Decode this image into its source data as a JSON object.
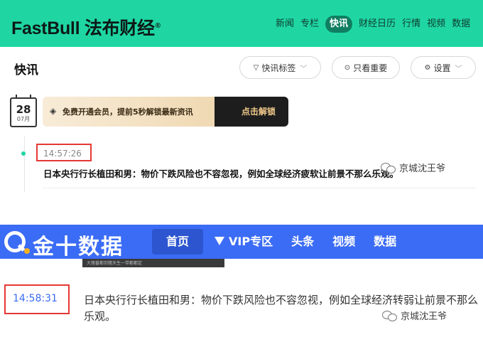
{
  "fastbull": {
    "logo": "FastBull 法布财经",
    "logo_reg": "®",
    "nav": [
      "新闻",
      "专栏",
      "快讯",
      "财经日历",
      "行情",
      "视频",
      "数据"
    ],
    "nav_active": "快讯",
    "page_title": "快讯",
    "filters": {
      "tags_label": "快讯标签",
      "important_label": "只看重要",
      "settings_label": "设置"
    },
    "calendar": {
      "day": "28",
      "month": "07月"
    },
    "vip_banner": {
      "text": "免费开通会员，提前5秒解锁最新资讯",
      "button": "点击解锁",
      "colors": {
        "banner": "#f0d9b3",
        "button_bg": "#1d1d1d",
        "button_text": "#f1c98a"
      }
    },
    "item": {
      "time": "14:57:26",
      "text": "日本央行行长植田和男：物价下跌风险也不容忽视，例如全球经济疲软让前景不那么乐观。"
    },
    "colors": {
      "header_bg": "#1fd6a3",
      "nav_active_bg": "#0f7e61"
    }
  },
  "jin10": {
    "logo": "金十数据",
    "nav": [
      "首页",
      "VIP专区",
      "头条",
      "视频",
      "数据"
    ],
    "nav_active": "首页",
    "thumb_caption": "大猪番都到猪天生一带都都定",
    "item": {
      "time": "14:58:31",
      "text": "日本央行行长植田和男：物价下跌风险也不容忽视，例如全球经济转弱让前景不那么乐观。"
    },
    "colors": {
      "header_bg": "#3b6cf5",
      "time_text": "#3b6cf5",
      "logo_accent": "#f6b11c"
    }
  },
  "watermark": "京城沈王爷",
  "highlight_color": "#e53935"
}
